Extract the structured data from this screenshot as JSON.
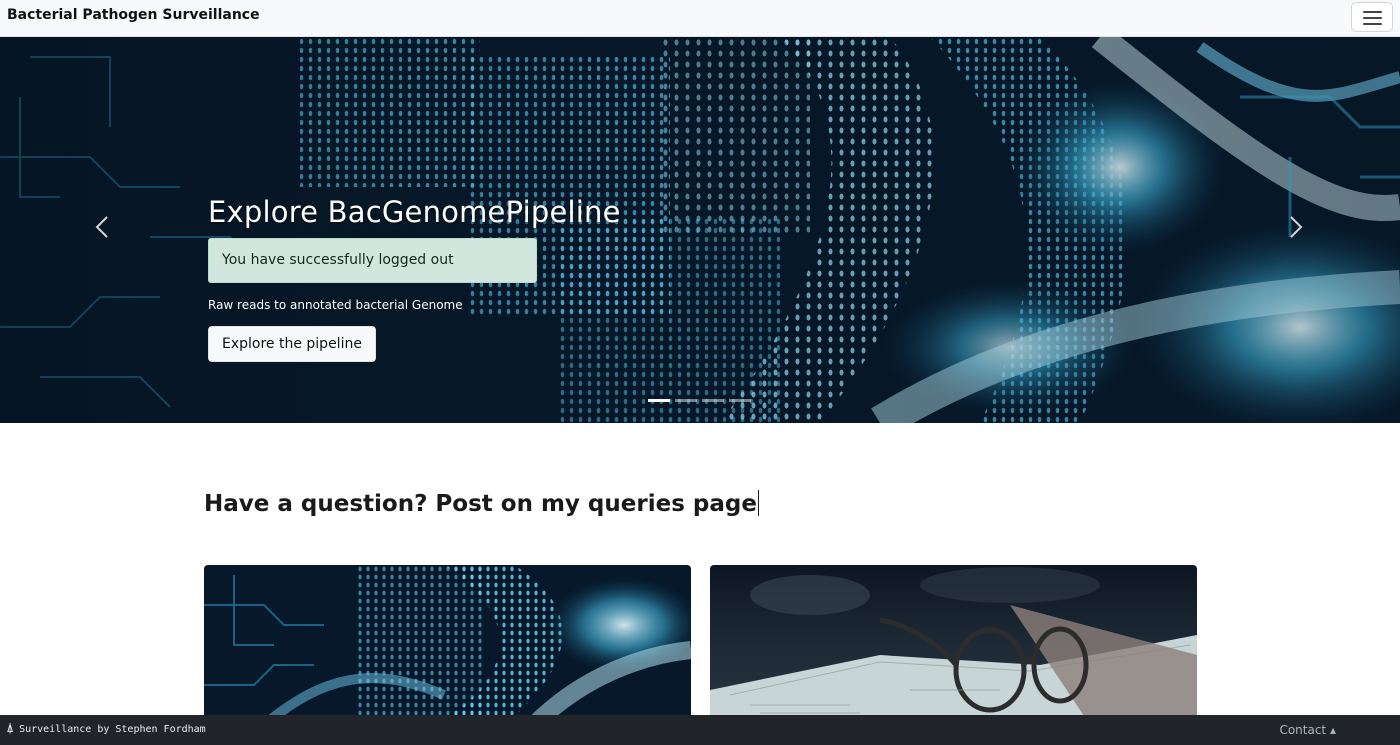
{
  "navbar": {
    "brand": "Bacterial Pathogen Surveillance",
    "menu_icon": "hamburger-menu-icon"
  },
  "hero": {
    "title": "Explore BacGenomePipeline",
    "alert": "You have successfully logged out",
    "subtitle": "Raw reads to annotated bacterial Genome",
    "button_label": "Explore the pipeline",
    "prev_icon": "chevron-left-icon",
    "next_icon": "chevron-right-icon",
    "slides_total": 4,
    "active_slide": 1
  },
  "main": {
    "heading": "Have a question? Post on my queries page",
    "cards": [
      {
        "image": "dna-circuit-image"
      },
      {
        "image": "book-glasses-image"
      }
    ]
  },
  "footer": {
    "left_text": "Surveillance by Stephen Fordham",
    "contact_label": "Contact",
    "contact_icon": "caret-up-icon"
  },
  "colors": {
    "navbar_bg": "#f8f9fa",
    "hero_bg": "#061523",
    "hero_accent": "#35c8f0",
    "alert_bg": "#d1e7dd",
    "footer_bg": "#212529"
  }
}
